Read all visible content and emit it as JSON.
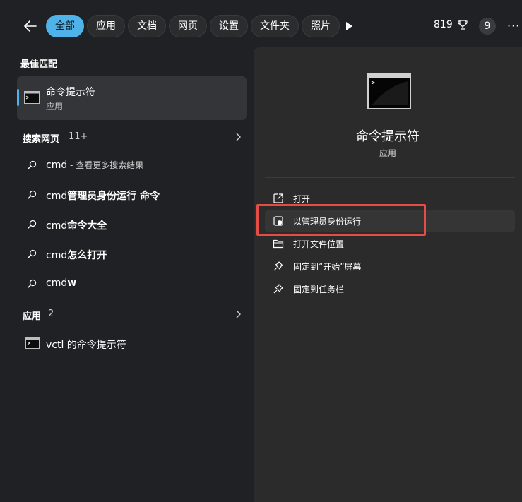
{
  "topbar": {
    "tabs": [
      {
        "label": "全部",
        "active": true
      },
      {
        "label": "应用",
        "active": false
      },
      {
        "label": "文档",
        "active": false
      },
      {
        "label": "网页",
        "active": false
      },
      {
        "label": "设置",
        "active": false
      },
      {
        "label": "文件夹",
        "active": false
      },
      {
        "label": "照片",
        "active": false
      }
    ],
    "points": "819",
    "badge": "9",
    "more": "···"
  },
  "left": {
    "best_match_title": "最佳匹配",
    "best_match": {
      "title": "命令提示符",
      "sub": "应用"
    },
    "web_section": {
      "label": "搜索网页",
      "count": "11+"
    },
    "web_results": [
      {
        "bold": "",
        "plain": "cmd",
        "hint": " - 查看更多搜索结果"
      },
      {
        "plain": "cmd",
        "bold": "管理员身份运行 命令",
        "hint": ""
      },
      {
        "plain": "cmd",
        "bold": "命令大全",
        "hint": ""
      },
      {
        "plain": "cmd",
        "bold": "怎么打开",
        "hint": ""
      },
      {
        "plain": "cmd",
        "bold": "w",
        "hint": ""
      }
    ],
    "apps_section": {
      "label": "应用",
      "count": "2"
    },
    "app_result": "vctl 的命令提示符"
  },
  "right": {
    "title": "命令提示符",
    "subtitle": "应用",
    "actions": [
      {
        "label": "打开",
        "icon": "open-external-icon"
      },
      {
        "label": "以管理员身份运行",
        "icon": "shield-icon"
      },
      {
        "label": "打开文件位置",
        "icon": "folder-icon"
      },
      {
        "label": "固定到“开始”屏幕",
        "icon": "pin-icon"
      },
      {
        "label": "固定到任务栏",
        "icon": "pin-icon"
      }
    ]
  },
  "colors": {
    "accent": "#4fb3ea",
    "highlight": "#e34d46"
  }
}
